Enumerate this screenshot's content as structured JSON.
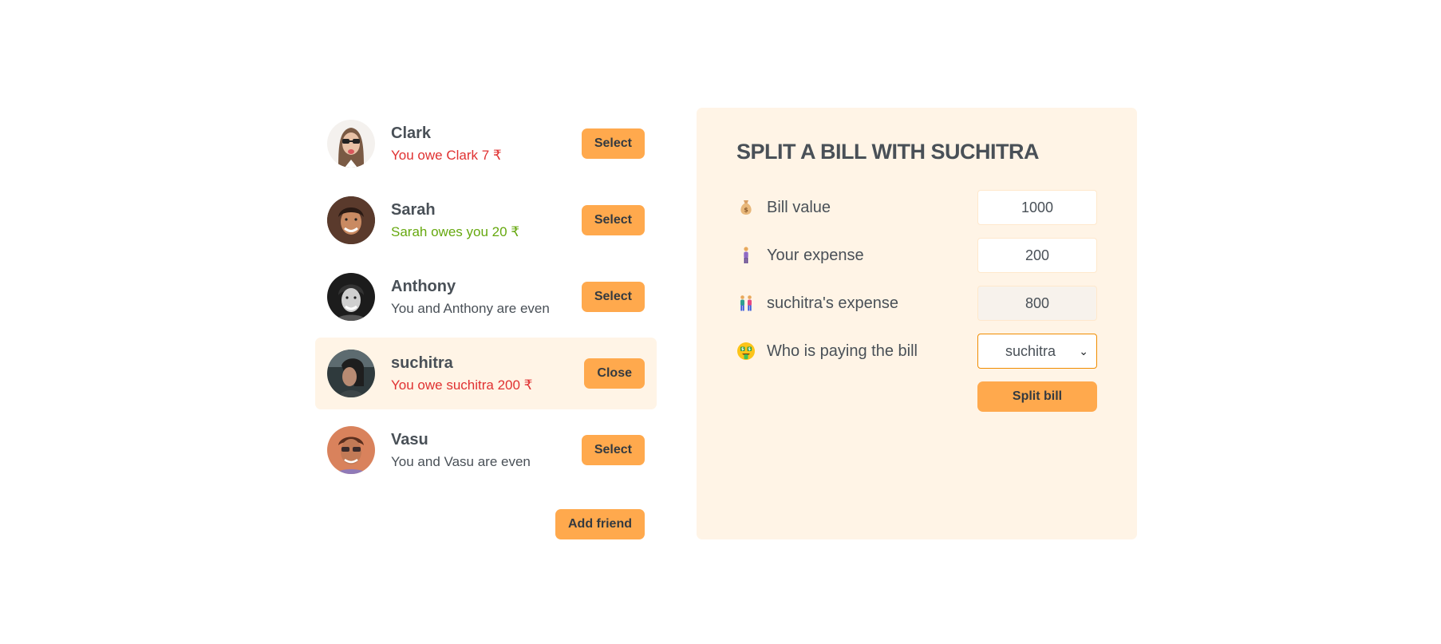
{
  "friends": [
    {
      "name": "Clark",
      "status": "You owe Clark 7 ₹",
      "status_type": "red",
      "button": "Select",
      "selected": false
    },
    {
      "name": "Sarah",
      "status": "Sarah owes you 20 ₹",
      "status_type": "green",
      "button": "Select",
      "selected": false
    },
    {
      "name": "Anthony",
      "status": "You and Anthony are even",
      "status_type": "even",
      "button": "Select",
      "selected": false
    },
    {
      "name": "suchitra",
      "status": "You owe suchitra 200 ₹",
      "status_type": "red",
      "button": "Close",
      "selected": true
    },
    {
      "name": "Vasu",
      "status": "You and Vasu are even",
      "status_type": "even",
      "button": "Select",
      "selected": false
    }
  ],
  "add_friend_label": "Add friend",
  "split": {
    "title": "Split a bill with suchitra",
    "bill_label": "Bill value",
    "bill_icon": "money-bag-icon",
    "bill_value": "1000",
    "your_label": "Your expense",
    "your_icon": "standing-person-icon",
    "your_value": "200",
    "friend_label": "suchitra's expense",
    "friend_icon": "two-people-icon",
    "friend_value": "800",
    "payer_label": "Who is paying the bill",
    "payer_icon": "money-mouth-face-icon",
    "payer_value": "suchitra",
    "submit_label": "Split bill"
  },
  "colors": {
    "accent": "#ffa94d",
    "panel_bg": "#fff4e6",
    "text": "#495057",
    "owe_red": "#e03131",
    "owed_green": "#66a80f"
  }
}
